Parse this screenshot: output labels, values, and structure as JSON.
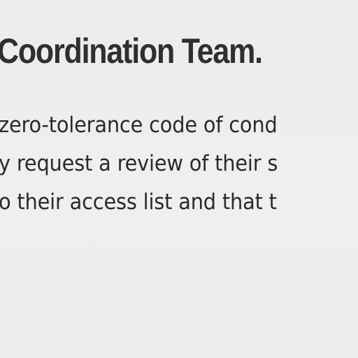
{
  "document": {
    "heading": "Coordination Team.",
    "lines": [
      "zero-tolerance code of cond",
      "y request a review of their s",
      "o their access list and that t"
    ]
  }
}
